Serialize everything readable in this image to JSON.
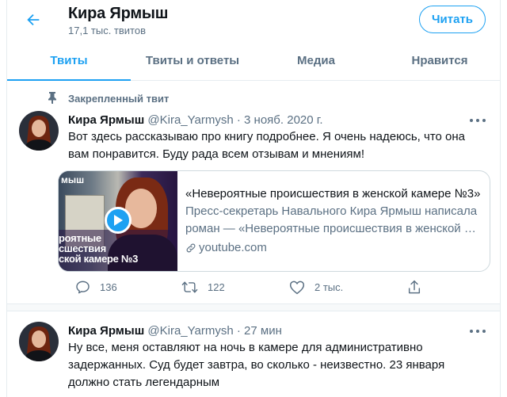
{
  "header": {
    "name": "Кира Ярмыш",
    "tweet_count": "17,1 тыс. твитов",
    "follow_label": "Читать"
  },
  "tabs": [
    {
      "label": "Твиты",
      "active": true
    },
    {
      "label": "Твиты и ответы",
      "active": false
    },
    {
      "label": "Медиа",
      "active": false
    },
    {
      "label": "Нравится",
      "active": false
    }
  ],
  "tweets": [
    {
      "pinned_label": "Закрепленный твит",
      "name": "Кира Ярмыш",
      "handle": "@Kira_Yarmysh",
      "separator": "·",
      "time": "3 нояб. 2020 г.",
      "lines": [
        "Вот здесь рассказываю про книгу подробнее. Я очень надеюсь, что она",
        "вам понравится. Буду рада всем отзывам и мнениям!"
      ],
      "card": {
        "thumb_top_text": "мыш",
        "thumb_overlay_text": "роятные\nсшествия\nской камере №3",
        "title": "«Невероятные происшествия в женской камере №3»",
        "desc_lines": [
          "Пресс-секретарь Навального Кира Ярмыш написала",
          "роман — «Невероятные происшествия в женской …"
        ],
        "domain": "youtube.com"
      },
      "replies": "136",
      "retweets": "122",
      "likes": "2 тыс."
    },
    {
      "name": "Кира Ярмыш",
      "handle": "@Kira_Yarmysh",
      "separator": "·",
      "time": "27 мин",
      "lines": [
        "Ну все, меня оставляют на ночь в камере для административно",
        "задержанных. Суд будет завтра, во сколько - неизвестно. 23 января",
        "должно стать легендарным"
      ]
    }
  ],
  "colors": {
    "accent": "#1da1f2",
    "secondary_text": "#5b7083",
    "primary_text": "#0f1419",
    "border": "#e6ecf0"
  },
  "icons": [
    "back-arrow-icon",
    "pin-icon",
    "more-icon",
    "play-icon",
    "link-icon",
    "reply-icon",
    "retweet-icon",
    "like-icon",
    "share-icon"
  ]
}
